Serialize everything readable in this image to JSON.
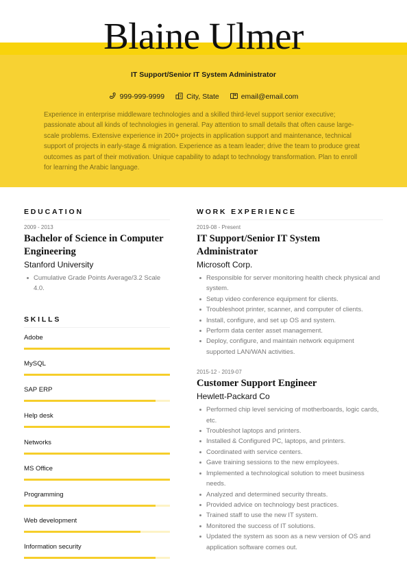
{
  "header": {
    "name": "Blaine Ulmer",
    "role": "IT Support/Senior IT System Administrator",
    "contacts": [
      {
        "icon": "phone-icon",
        "text": "999-999-9999"
      },
      {
        "icon": "location-icon",
        "text": "City, State"
      },
      {
        "icon": "mailbox-icon",
        "text": "email@email.com"
      }
    ],
    "summary": "Experience in enterprise middleware technologies and a skilled third-level support senior executive; passionate about all kinds of technologies in general. Pay attention to small details that often cause large-scale problems. Extensive experience in 200+ projects in application support and maintenance, technical support of projects in early-stage & migration. Experience as a team leader; drive the team to produce great outcomes as part of their motivation. Unique capability to adapt to technology transformation. Plan to enroll for learning the Arabic language."
  },
  "colors": {
    "accent": "#F7D233",
    "accent_strip": "#F8D30B",
    "skill_fill": "#F6CE2A",
    "skill_track": "#FDF3C6"
  },
  "education": {
    "title": "EDUCATION",
    "items": [
      {
        "date": "2009 - 2013",
        "degree": "Bachelor of Science in Computer Engineering",
        "school": "Stanford University",
        "bullets": [
          "Cumulative Grade Points Average/3.2 Scale 4.0."
        ]
      }
    ]
  },
  "skills": {
    "title": "SKILLS",
    "items": [
      {
        "name": "Adobe",
        "level": 100
      },
      {
        "name": "MySQL",
        "level": 100
      },
      {
        "name": "SAP ERP",
        "level": 90
      },
      {
        "name": "Help desk",
        "level": 100
      },
      {
        "name": "Networks",
        "level": 100
      },
      {
        "name": "MS Office",
        "level": 100
      },
      {
        "name": "Programming",
        "level": 90
      },
      {
        "name": "Web development",
        "level": 80
      },
      {
        "name": "Information security",
        "level": 90
      }
    ]
  },
  "work": {
    "title": "WORK EXPERIENCE",
    "jobs": [
      {
        "date": "2019-08 - Present",
        "title": "IT Support/Senior IT System Administrator",
        "company": "Microsoft Corp.",
        "bullets": [
          "Responsible for server monitoring health check physical and system.",
          "Setup video conference equipment for clients.",
          "Troubleshoot printer, scanner, and computer of clients.",
          "Install, configure, and set up OS and system.",
          "Perform data center asset management.",
          "Deploy, configure, and maintain network equipment supported LAN/WAN activities."
        ]
      },
      {
        "date": "2015-12 - 2019-07",
        "title": "Customer Support Engineer",
        "company": "Hewlett-Packard Co",
        "bullets": [
          "Performed chip level servicing of motherboards, logic cards, etc.",
          "Troubleshot laptops and printers.",
          "Installed & Configured PC, laptops, and printers.",
          "Coordinated with service centers.",
          "Gave training sessions to the new employees.",
          "Implemented a technological solution to meet business needs.",
          "Analyzed and determined security threats.",
          "Provided advice on technology best practices.",
          "Trained staff to use the new IT system.",
          "Monitored the success of IT solutions.",
          "Updated the system as soon as a new version of OS and application software comes out."
        ]
      }
    ]
  }
}
